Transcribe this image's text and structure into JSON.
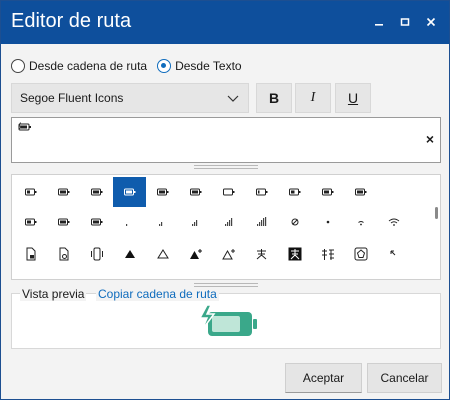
{
  "window": {
    "title": "Editor de ruta",
    "controls": {
      "minimize_icon": "minimize-icon",
      "maximize_icon": "maximize-icon",
      "close_icon": "close-icon"
    }
  },
  "source": {
    "options": [
      {
        "label": "Desde cadena de ruta",
        "selected": false
      },
      {
        "label": "Desde Texto",
        "selected": true
      }
    ]
  },
  "font": {
    "selected": "Segoe Fluent Icons",
    "bold_label": "B",
    "italic_label": "I",
    "underline_label": "U"
  },
  "text_input": {
    "value_icon": "battery-charging-icon",
    "clear_label": "×"
  },
  "glyph_grid": {
    "selected_index": 3,
    "rows": [
      [
        "battery-icon",
        "battery-charging-icon",
        "battery-charging-icon",
        "battery-charging-icon",
        "battery-charging-icon",
        "battery-charging-icon",
        "battery-low-icon",
        "battery-low-icon",
        "battery-icon",
        "battery-charging-icon",
        "battery-charging-icon"
      ],
      [
        "battery-icon",
        "battery-charging-icon",
        "battery-charging-icon",
        "signal-1-icon",
        "signal-2-icon",
        "signal-3-icon",
        "signal-4-icon",
        "signal-full-icon",
        "no-signal-icon",
        "dot-icon",
        "wifi-low-icon",
        "wifi-icon"
      ],
      [
        "document-lock-icon",
        "document-link-icon",
        "phone-vibrate-icon",
        "triangle-filled-icon",
        "triangle-outline-icon",
        "triangle-add-filled-icon",
        "triangle-add-outline-icon",
        "ime-english-icon",
        "ime-english-box-icon",
        "ime-japanese-icon",
        "ime-box-icon",
        "resize-corner-icon"
      ]
    ]
  },
  "preview": {
    "label": "Vista previa",
    "link": "Copiar cadena de ruta",
    "icon": "battery-charging-icon",
    "icon_color": "#3aa88a"
  },
  "buttons": {
    "ok": "Aceptar",
    "cancel": "Cancelar"
  },
  "colors": {
    "titlebar": "#0e4f9c",
    "accent": "#0f6cbd",
    "selection": "#0f5cad"
  }
}
